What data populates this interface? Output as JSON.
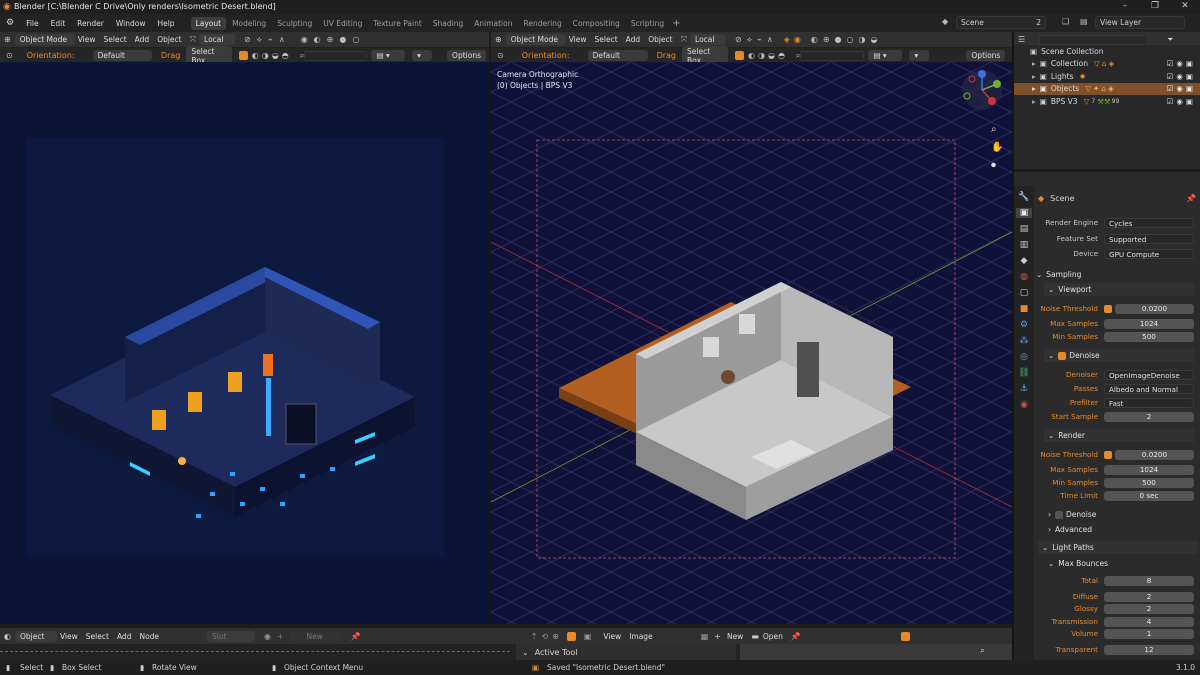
{
  "window": {
    "title": "Blender [C:\\Blender C Drive\\Only renders\\Isometric Desert.blend]",
    "controls": [
      "–",
      "❐",
      "✕"
    ]
  },
  "menu": [
    "File",
    "Edit",
    "Render",
    "Window",
    "Help"
  ],
  "workspaces": [
    "Layout",
    "Modeling",
    "Sculpting",
    "UV Editing",
    "Texture Paint",
    "Shading",
    "Animation",
    "Rendering",
    "Compositing",
    "Scripting"
  ],
  "scene": {
    "name": "Scene",
    "count": "2",
    "view_layer": "View Layer"
  },
  "viewport_header": {
    "mode": "Object Mode",
    "menus": [
      "View",
      "Select",
      "Add",
      "Object"
    ],
    "transform": "Local",
    "orientation_label": "Orientation:",
    "orientation_value": "Default",
    "drag_label": "Drag",
    "drag_value": "Select Box",
    "options": "Options"
  },
  "right_viewport": {
    "camera_label": "Camera Orthographic",
    "object_label": "(0) Objects | BPS V3"
  },
  "outliner": {
    "root": "Scene Collection",
    "items": [
      "Collection",
      "Lights",
      "Objects",
      "BPS V3"
    ],
    "bps_extra": "7",
    "bps_extra2": "99"
  },
  "properties": {
    "header_title": "Scene",
    "render_engine_label": "Render Engine",
    "render_engine": "Cycles",
    "feature_set_label": "Feature Set",
    "feature_set": "Supported",
    "device_label": "Device",
    "device": "GPU Compute",
    "sampling": "Sampling",
    "viewport_panel": "Viewport",
    "noise_threshold_label": "Noise Threshold",
    "vp_noise_threshold": "0.0200",
    "max_samples_label": "Max Samples",
    "vp_max_samples": "1024",
    "min_samples_label": "Min Samples",
    "vp_min_samples": "500",
    "denoise_label": "Denoise",
    "denoiser_label": "Denoiser",
    "denoiser": "OpenImageDenoise",
    "passes_label": "Passes",
    "passes": "Albedo and Normal",
    "prefilter_label": "Prefilter",
    "prefilter": "Fast",
    "start_sample_label": "Start Sample",
    "start_sample": "2",
    "render_panel": "Render",
    "r_noise_threshold": "0.0200",
    "r_max_samples": "1024",
    "r_min_samples": "500",
    "time_limit_label": "Time Limit",
    "time_limit": "0 sec",
    "advanced": "Advanced",
    "light_paths": "Light Paths",
    "max_bounces": "Max Bounces",
    "total_label": "Total",
    "total": "8",
    "diffuse_label": "Diffuse",
    "diffuse": "2",
    "glossy_label": "Glossy",
    "glossy": "2",
    "transmission_label": "Transmission",
    "transmission": "4",
    "volume_label": "Volume",
    "volume": "1",
    "transparent_label": "Transparent",
    "transparent": "12"
  },
  "bottom": {
    "editor_mode": "Object",
    "menus_left": [
      "View",
      "Select",
      "Add",
      "Node"
    ],
    "slot": "Slot",
    "new_left": "New",
    "menus_right": [
      "View",
      "Image"
    ],
    "new_right": "New",
    "open": "Open",
    "active_tool": "Active Tool"
  },
  "status": {
    "select": "Select",
    "box_select": "Box Select",
    "rotate_view": "Rotate View",
    "context_menu": "Object Context Menu",
    "saved": "Saved \"Isometric Desert.blend\"",
    "version": "3.1.0"
  },
  "colors": {
    "accent": "#e88a2b",
    "selected_row": "#80502a"
  }
}
